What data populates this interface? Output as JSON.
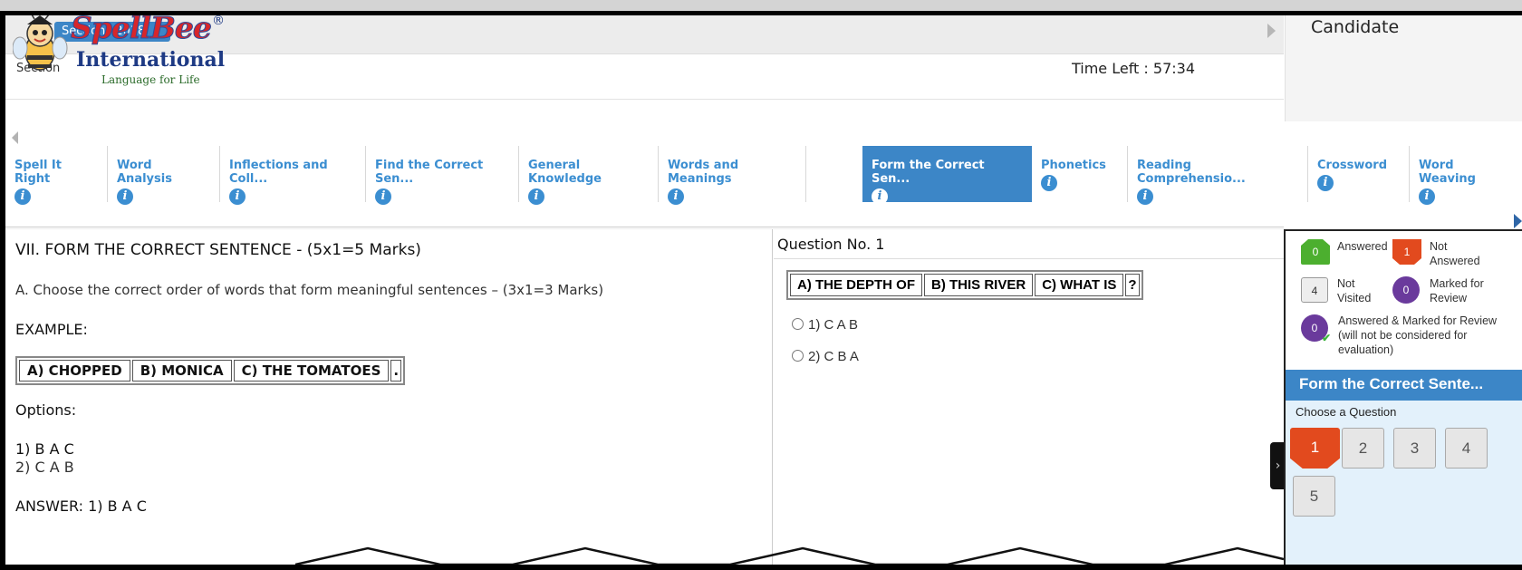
{
  "header": {
    "section_label": "Section",
    "section_chip": "Sections 2018",
    "time_left": "Time Left : 57:34",
    "candidate": "Candidate"
  },
  "logo": {
    "word": "SpellBee",
    "reg": "®",
    "sub": "International",
    "tagline": "Language for Life"
  },
  "tabs": [
    {
      "label": "Spell It Right"
    },
    {
      "label": "Word Analysis"
    },
    {
      "label": "Inflections and Coll..."
    },
    {
      "label": "Find the Correct Sen..."
    },
    {
      "label": "General Knowledge"
    },
    {
      "label": "Words and Meanings"
    },
    {
      "label": "Form the Correct Sen...",
      "active": true
    },
    {
      "label": "Phonetics"
    },
    {
      "label": "Reading Comprehensio..."
    },
    {
      "label": "Crossword"
    },
    {
      "label": "Word Weaving"
    }
  ],
  "passage": {
    "title": "VII. FORM THE CORRECT SENTENCE - (5x1=5 Marks)",
    "instruction": "A. Choose the correct order of words that form meaningful sentences – (3x1=3 Marks)",
    "example_label": "EXAMPLE:",
    "example_words": [
      "A) CHOPPED",
      "B) MONICA",
      "C) THE TOMATOES",
      "."
    ],
    "options_label": "Options:",
    "option1": "1) B A C",
    "option2": "2) C A B",
    "answer": "ANSWER: 1) B A C"
  },
  "question": {
    "heading": "Question No. 1",
    "words": [
      "A) THE DEPTH OF",
      "B) THIS RIVER",
      "C) WHAT IS",
      "?"
    ],
    "options": [
      "1) C A B",
      "2) C B A"
    ]
  },
  "legend": {
    "answered": "Answered",
    "answered_count": "0",
    "not_answered": "Not Answered",
    "not_answered_count": "1",
    "not_visited": "Not Visited",
    "not_visited_count": "4",
    "marked": "Marked for Review",
    "marked_count": "0",
    "answered_marked": "Answered & Marked for Review (will not be considered for evaluation)",
    "answered_marked_count": "0"
  },
  "palette": {
    "section_title": "Form the Correct Sente...",
    "choose_label": "Choose a Question",
    "questions": [
      "1",
      "2",
      "3",
      "4",
      "5"
    ]
  },
  "colors": {
    "accent": "#3c86c7",
    "answered": "#4caf2f",
    "not_answered": "#e24a1e",
    "marked": "#6a3a9c"
  }
}
